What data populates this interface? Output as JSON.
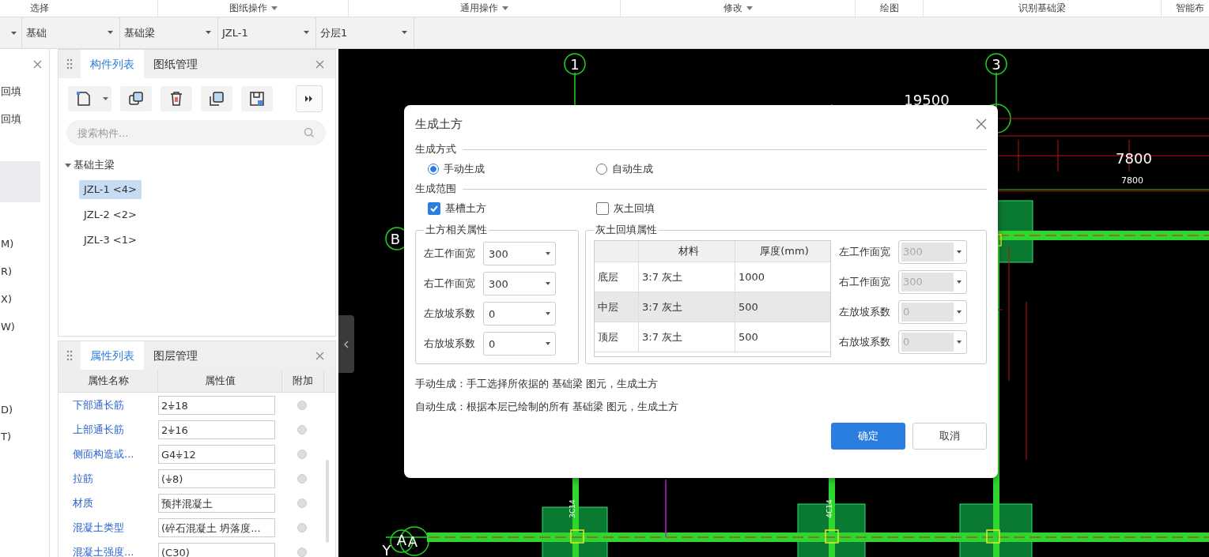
{
  "toolbar": {
    "groups": [
      {
        "label": "选择",
        "dropdown": false
      },
      {
        "label": "图纸操作",
        "dropdown": true
      },
      {
        "label": "通用操作",
        "dropdown": true
      },
      {
        "label": "修改",
        "dropdown": true
      },
      {
        "label": "绘图",
        "dropdown": false
      },
      {
        "label": "识别基础梁",
        "dropdown": false
      },
      {
        "label": "智能布",
        "dropdown": false
      }
    ]
  },
  "selectors": [
    {
      "value": "基础"
    },
    {
      "value": "基础梁"
    },
    {
      "value": "JZL-1"
    },
    {
      "value": "分层1"
    }
  ],
  "left_panel": {
    "items": [
      {
        "label": "回填"
      },
      {
        "label": "回填"
      },
      {
        "label": "M)"
      },
      {
        "label": "R)"
      },
      {
        "label": "X)"
      },
      {
        "label": "W)"
      },
      {
        "label": "D)"
      },
      {
        "label": "T)"
      }
    ]
  },
  "component_panel": {
    "tabs": [
      {
        "label": "构件列表",
        "selected": true
      },
      {
        "label": "图纸管理",
        "selected": false
      }
    ],
    "search": {
      "placeholder": "搜索构件..."
    },
    "tree": [
      {
        "label": "基础主梁",
        "expanded": true,
        "children": [
          {
            "label": "JZL-1 <4>",
            "selected": true
          },
          {
            "label": "JZL-2 <2>",
            "selected": false
          },
          {
            "label": "JZL-3 <1>",
            "selected": false
          }
        ]
      }
    ]
  },
  "property_panel": {
    "tabs": [
      {
        "label": "属性列表",
        "selected": true
      },
      {
        "label": "图层管理",
        "selected": false
      }
    ],
    "columns": [
      "属性名称",
      "属性值",
      "附加"
    ],
    "rows": [
      {
        "name": "下部通长筋",
        "value": "2⏚18",
        "attached": false
      },
      {
        "name": "上部通长筋",
        "value": "2⏚16",
        "attached": false
      },
      {
        "name": "侧面构造或...",
        "value": "G4⏚12",
        "attached": false
      },
      {
        "name": "拉筋",
        "value": "(⏚8)",
        "attached": false
      },
      {
        "name": "材质",
        "value": "预拌混凝土",
        "attached": false
      },
      {
        "name": "混凝土类型",
        "value": "(碎石混凝土 坍落度...",
        "attached": false
      },
      {
        "name": "混凝土强度...",
        "value": "(C30)",
        "attached": false
      }
    ]
  },
  "canvas": {
    "labels": [
      {
        "kind": "axis",
        "text": "1"
      },
      {
        "kind": "axis",
        "text": "3"
      },
      {
        "kind": "dim",
        "text": "19500"
      },
      {
        "kind": "dim",
        "text": "7800"
      },
      {
        "kind": "dimsmall",
        "text": "7800"
      },
      {
        "kind": "axis",
        "text": "B"
      },
      {
        "kind": "axis",
        "text": "A"
      },
      {
        "kind": "plain",
        "text": "A"
      },
      {
        "kind": "plain",
        "text": "Y"
      },
      {
        "kind": "column",
        "text": "3C14"
      },
      {
        "kind": "column",
        "text": "4C14"
      }
    ]
  },
  "dialog": {
    "title": "生成土方",
    "method": {
      "title": "生成方式",
      "options": [
        {
          "label": "手动生成",
          "selected": true
        },
        {
          "label": "自动生成",
          "selected": false
        }
      ]
    },
    "scope": {
      "title": "生成范围",
      "options": [
        {
          "label": "基槽土方",
          "checked": true
        },
        {
          "label": "灰土回填",
          "checked": false
        }
      ]
    },
    "earth_props": {
      "title": "土方相关属性",
      "fields": [
        {
          "label": "左工作面宽",
          "value": "300",
          "disabled": false
        },
        {
          "label": "右工作面宽",
          "value": "300",
          "disabled": false
        },
        {
          "label": "左放坡系数",
          "value": "0",
          "disabled": false
        },
        {
          "label": "右放坡系数",
          "value": "0",
          "disabled": false
        }
      ]
    },
    "backfill_props": {
      "title": "灰土回填属性",
      "columns": [
        "材料",
        "厚度(mm)"
      ],
      "rows": [
        {
          "layer": "底层",
          "material": "3:7 灰土",
          "thickness": "1000",
          "selected": false
        },
        {
          "layer": "中层",
          "material": "3:7 灰土",
          "thickness": "500",
          "selected": true
        },
        {
          "layer": "顶层",
          "material": "3:7 灰土",
          "thickness": "500",
          "selected": false
        }
      ],
      "fields": [
        {
          "label": "左工作面宽",
          "value": "300",
          "disabled": true
        },
        {
          "label": "右工作面宽",
          "value": "300",
          "disabled": true
        },
        {
          "label": "左放坡系数",
          "value": "0",
          "disabled": true
        },
        {
          "label": "右放坡系数",
          "value": "0",
          "disabled": true
        }
      ]
    },
    "notes": [
      "手动生成：手工选择所依据的 基础梁 图元，生成土方",
      "自动生成：根据本层已绘制的所有 基础梁 图元，生成土方"
    ],
    "buttons": [
      {
        "label": "确定",
        "primary": true
      },
      {
        "label": "取消",
        "primary": false
      }
    ]
  }
}
